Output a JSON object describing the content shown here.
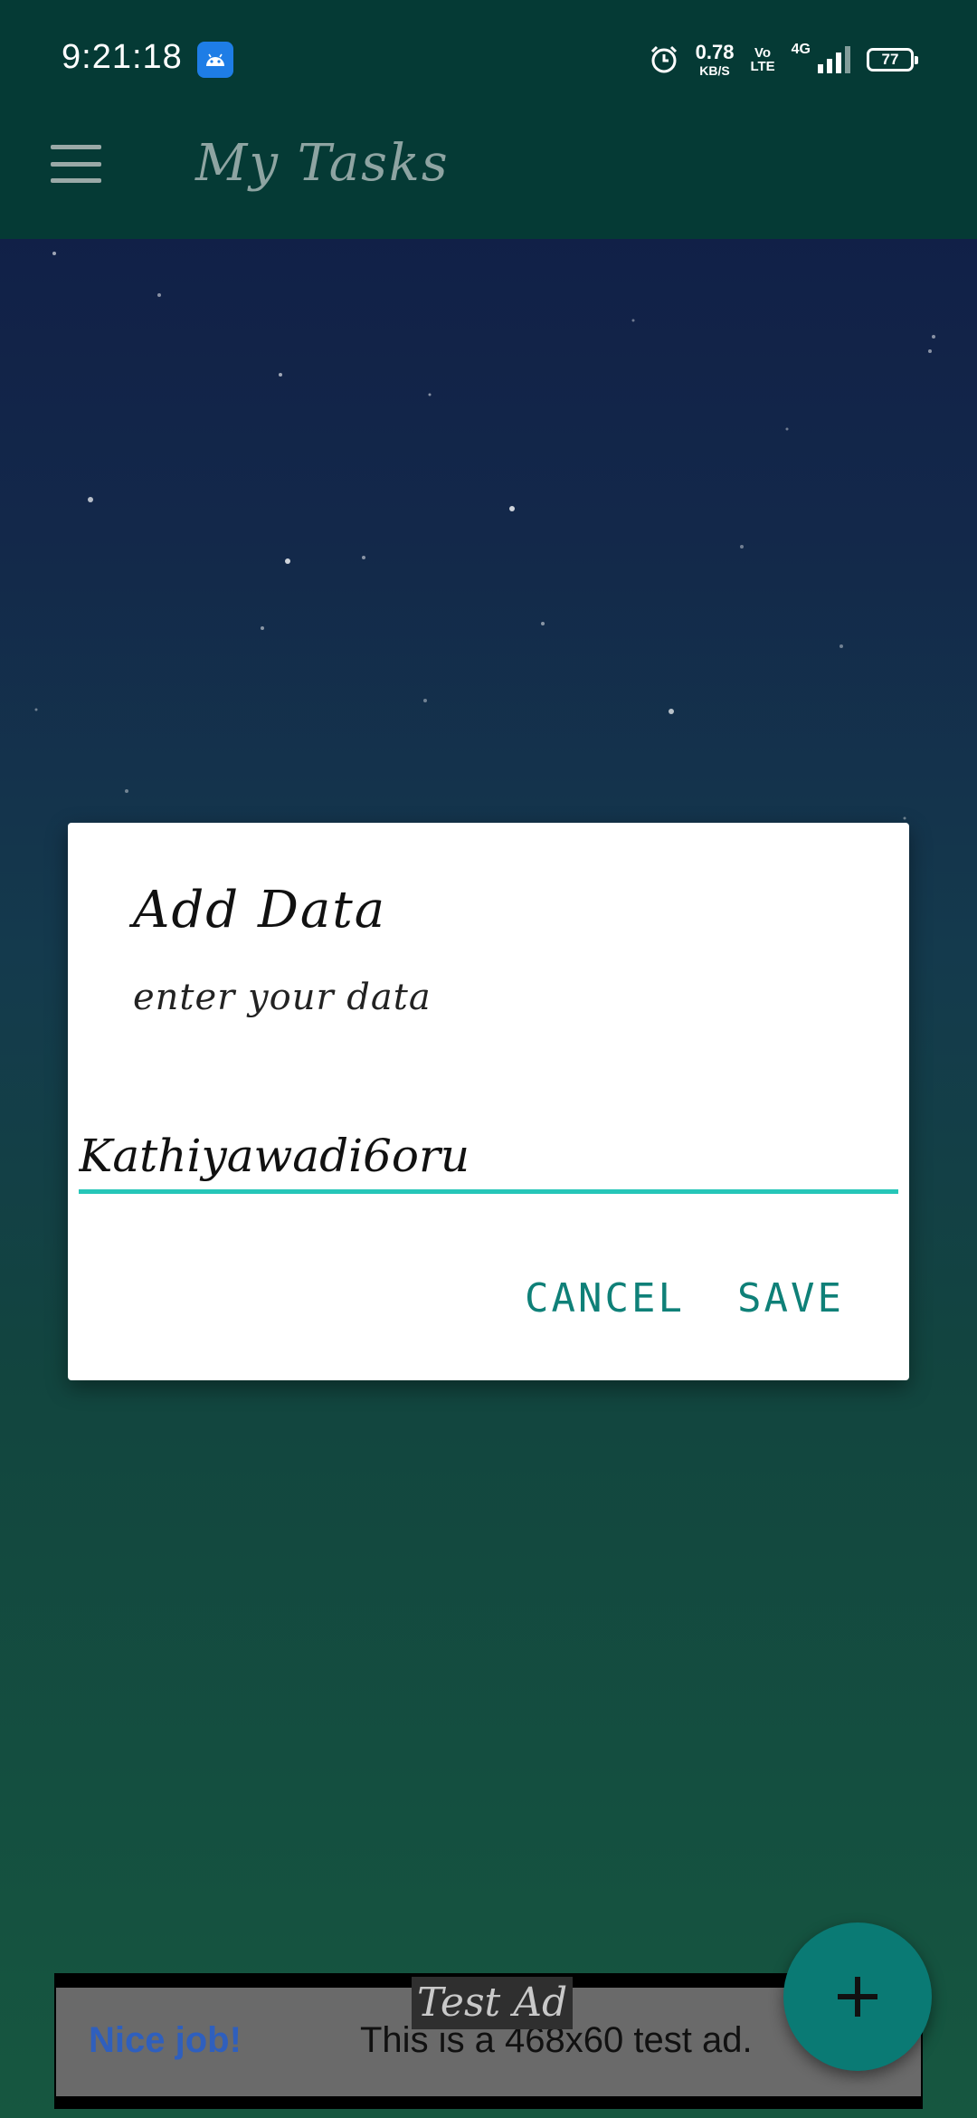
{
  "status_bar": {
    "time": "9:21:18",
    "network_speed": "0.78",
    "network_speed_unit": "KB/S",
    "volte_line1": "Vo",
    "volte_line2": "LTE",
    "network_type": "4G",
    "battery": "77"
  },
  "app_bar": {
    "title": "My Tasks",
    "menu_icon": "hamburger-menu-icon"
  },
  "dialog": {
    "title": "Add Data",
    "message": "enter your data",
    "input_value": "Kathiyawadi6oru",
    "cancel_label": "CANCEL",
    "save_label": "SAVE",
    "accent_color": "#26c6b8"
  },
  "ad": {
    "label": "Test Ad",
    "nice_job": "Nice job!",
    "text": "This is a 468x60 test ad."
  },
  "fab": {
    "icon": "plus-icon",
    "color": "#0a7a74"
  }
}
